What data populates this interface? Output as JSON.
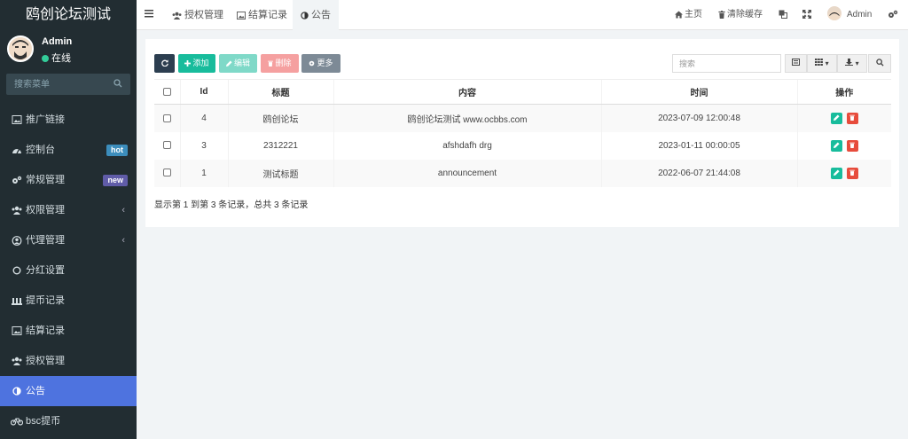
{
  "app": {
    "title": "鸥创论坛测试"
  },
  "user": {
    "name": "Admin",
    "status": "在线"
  },
  "sidebar": {
    "search_placeholder": "搜索菜单",
    "items": [
      {
        "label": "推广链接",
        "icon": "image-icon"
      },
      {
        "label": "控制台",
        "icon": "dashboard-icon",
        "badge": "hot"
      },
      {
        "label": "常规管理",
        "icon": "cogs-icon",
        "badge": "new"
      },
      {
        "label": "权限管理",
        "icon": "group-icon",
        "arrow": "‹"
      },
      {
        "label": "代理管理",
        "icon": "user-circle-icon",
        "arrow": "‹"
      },
      {
        "label": "分红设置",
        "icon": "circle-icon"
      },
      {
        "label": "提币记录",
        "icon": "bank-icon"
      },
      {
        "label": "结算记录",
        "icon": "image-icon"
      },
      {
        "label": "授权管理",
        "icon": "group-icon"
      },
      {
        "label": "公告",
        "icon": "adjust-icon"
      },
      {
        "label": "bsc提币",
        "icon": "bicycle-icon"
      }
    ]
  },
  "header": {
    "tabs": [
      {
        "label": "授权管理",
        "icon": "group-icon"
      },
      {
        "label": "结算记录",
        "icon": "image-icon"
      },
      {
        "label": "公告",
        "icon": "adjust-icon"
      }
    ],
    "home_label": "主页",
    "clear_cache_label": "清除缓存",
    "user_label": "Admin"
  },
  "toolbar": {
    "add_label": "添加",
    "edit_label": "编辑",
    "delete_label": "删除",
    "more_label": "更多",
    "search_placeholder": "搜索"
  },
  "table": {
    "columns": [
      "Id",
      "标题",
      "内容",
      "时间",
      "操作"
    ],
    "rows": [
      {
        "id": "4",
        "title": "鸥创论坛",
        "content": "鸥创论坛测试 www.ocbbs.com",
        "time": "2023-07-09 12:00:48"
      },
      {
        "id": "3",
        "title": "2312221",
        "content": "afshdafh drg",
        "time": "2023-01-11 00:00:05"
      },
      {
        "id": "1",
        "title": "测试标题",
        "content": "announcement",
        "time": "2022-06-07 21:44:08"
      }
    ]
  },
  "pagination": {
    "info": "显示第 1 到第 3 条记录，总共 3 条记录"
  },
  "colors": {
    "sidebar_bg": "#222d32",
    "active": "#4e73df",
    "add": "#18bc9c",
    "delete": "#e74c3c"
  }
}
